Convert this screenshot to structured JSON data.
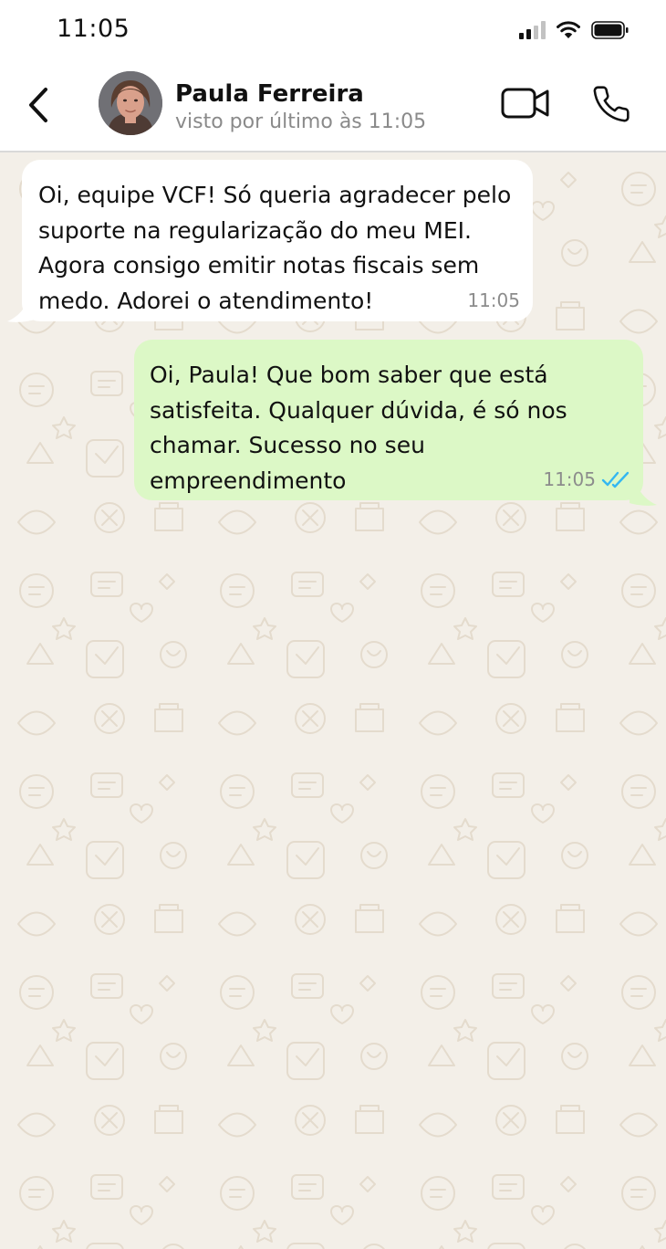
{
  "status_bar": {
    "time": "11:05",
    "icons": [
      "cellular-signal-icon",
      "wifi-icon",
      "battery-icon"
    ]
  },
  "header": {
    "contact_name": "Paula Ferreira",
    "contact_status": "visto por último às 11:05",
    "icons": [
      "back-chevron-icon",
      "video-camera-icon",
      "phone-icon"
    ]
  },
  "messages": [
    {
      "direction": "incoming",
      "text": "Oi, equipe VCF! Só queria agradecer pelo suporte na regularização do meu MEI. Agora consigo emitir notas fiscais sem medo. Adorei o atendimento!",
      "time": "11:05"
    },
    {
      "direction": "outgoing",
      "text": "Oi, Paula! Que bom saber que está satisfeita. Qualquer dúvida, é só nos chamar. Sucesso no seu empreendimento",
      "time": "11:05",
      "receipt_icon": "double-check-read-icon"
    }
  ],
  "colors": {
    "chat_background": "#f3efe8",
    "incoming_bubble": "#ffffff",
    "outgoing_bubble": "#dcf8c6",
    "read_receipt": "#34b7f1",
    "secondary_text": "#8c8c8c"
  }
}
